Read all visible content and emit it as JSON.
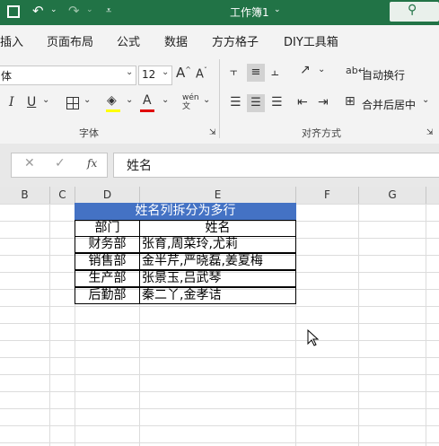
{
  "titlebar": {
    "title": "工作簿1"
  },
  "menu": [
    "插入",
    "页面布局",
    "公式",
    "数据",
    "方方格子",
    "DIY工具箱"
  ],
  "ribbon": {
    "font_name": "体",
    "font_size": "12",
    "wrap_text": "自动换行",
    "merge_center": "合并后居中",
    "font_group": "字体",
    "align_group": "对齐方式"
  },
  "formula_bar": {
    "fx_label": "fx",
    "content": "姓名"
  },
  "columns": [
    "B",
    "C",
    "D",
    "E",
    "F",
    "G"
  ],
  "table": {
    "title": "姓名列拆分为多行",
    "headers": [
      "部门",
      "姓名"
    ],
    "rows": [
      [
        "财务部",
        "张育,周菜玲,尤莉"
      ],
      [
        "销售部",
        "金半芹,严晓磊,姜夏梅"
      ],
      [
        "生产部",
        "张景玉,吕武琴"
      ],
      [
        "后勤部",
        "秦二丫,金孝诘"
      ]
    ]
  },
  "colors": {
    "accent": "#217346",
    "title_fill": "#4472c4"
  }
}
